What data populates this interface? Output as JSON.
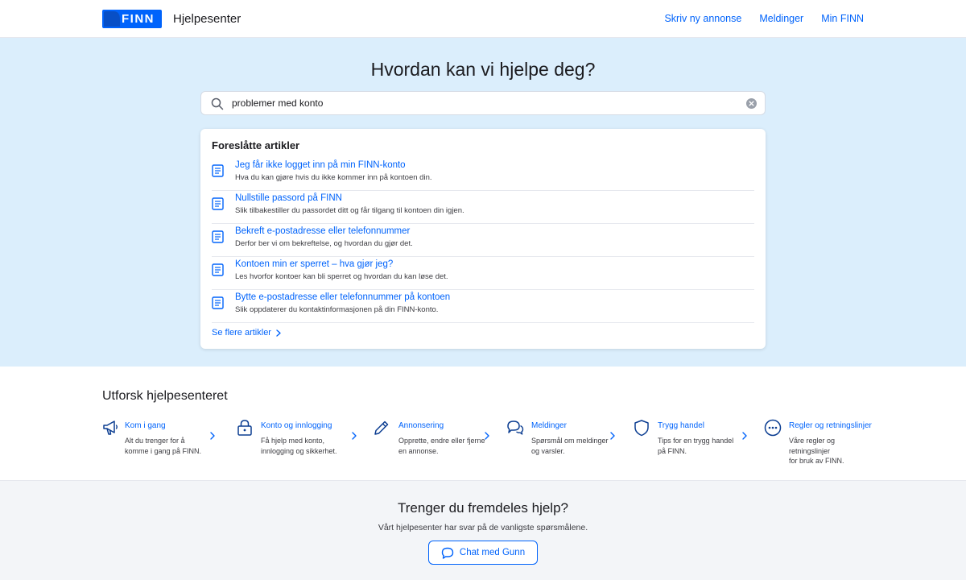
{
  "header": {
    "logo_text": "FINN",
    "title": "Hjelpesenter",
    "nav": [
      "Skriv ny annonse",
      "Meldinger",
      "Min FINN"
    ]
  },
  "hero": {
    "title": "Hvordan kan vi hjelpe deg?",
    "search_value": "problemer med konto"
  },
  "suggestions": {
    "title": "Foreslåtte artikler",
    "articles": [
      {
        "title": "Jeg får ikke logget inn på min FINN-konto",
        "desc": "Hva du kan gjøre hvis du ikke kommer inn på kontoen din."
      },
      {
        "title": "Nullstille passord på FINN",
        "desc": "Slik tilbakestiller du passordet ditt og får tilgang til kontoen din igjen."
      },
      {
        "title": "Bekreft e-postadresse eller telefonnummer",
        "desc": "Derfor ber vi om bekreftelse, og hvordan du gjør det."
      },
      {
        "title": "Kontoen min er sperret – hva gjør jeg?",
        "desc": "Les hvorfor kontoer kan bli sperret og hvordan du kan løse det."
      },
      {
        "title": "Bytte e-postadresse eller telefonnummer på kontoen",
        "desc": "Slik oppdaterer du kontaktinformasjonen på din FINN-konto."
      }
    ],
    "more_label": "Se flere artikler"
  },
  "explore": {
    "title": "Utforsk hjelpesenteret",
    "categories": [
      {
        "icon": "megaphone-icon",
        "title": "Kom i gang",
        "desc_lines": [
          "Alt du trenger for å",
          "komme i gang på FINN."
        ]
      },
      {
        "icon": "lock-icon",
        "title": "Konto og innlogging",
        "desc_lines": [
          "Få hjelp med konto,",
          "innlogging og sikkerhet."
        ]
      },
      {
        "icon": "pencil-icon",
        "title": "Annonsering",
        "desc_lines": [
          "Opprette, endre eller fjerne",
          "en annonse."
        ]
      },
      {
        "icon": "chat-bubbles-icon",
        "title": "Meldinger",
        "desc_lines": [
          "Spørsmål om meldinger",
          "og varsler."
        ]
      },
      {
        "icon": "shield-icon",
        "title": "Trygg handel",
        "desc_lines": [
          "Tips for en trygg handel",
          "på FINN."
        ]
      },
      {
        "icon": "ellipsis-circle-icon",
        "title": "Regler og retningslinjer",
        "desc_lines": [
          "Våre regler og retningslinjer",
          "for bruk av FINN."
        ]
      }
    ]
  },
  "help": {
    "title": "Trenger du fremdeles hjelp?",
    "subtitle": "Vårt hjelpesenter har svar på de vanligste spørsmålene.",
    "chat_label": "Chat med Gunn"
  },
  "colors": {
    "accent": "#0063fb",
    "hero_bg": "#dbeefc",
    "logo_blue": "#0063fb"
  }
}
